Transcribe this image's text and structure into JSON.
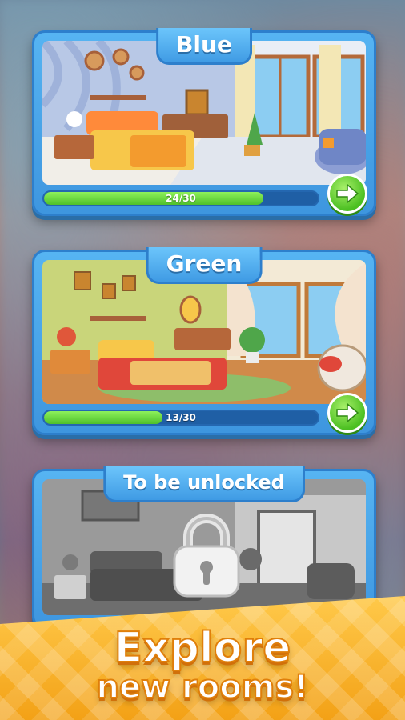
{
  "rooms": [
    {
      "title": "Blue",
      "progress_text": "24/30",
      "progress_fraction": 0.8,
      "state": "active"
    },
    {
      "title": "Green",
      "progress_text": "13/30",
      "progress_fraction": 0.433,
      "state": "active"
    },
    {
      "title": "To be unlocked",
      "state": "locked"
    }
  ],
  "promo": {
    "line1": "Explore",
    "line2": "new rooms!"
  },
  "colors": {
    "card_blue": "#3e96df",
    "progress_green": "#4fc02b",
    "button_green": "#4bbf21",
    "promo_orange": "#f3a116"
  },
  "icons": [
    "arrow-right-icon",
    "padlock-icon"
  ]
}
